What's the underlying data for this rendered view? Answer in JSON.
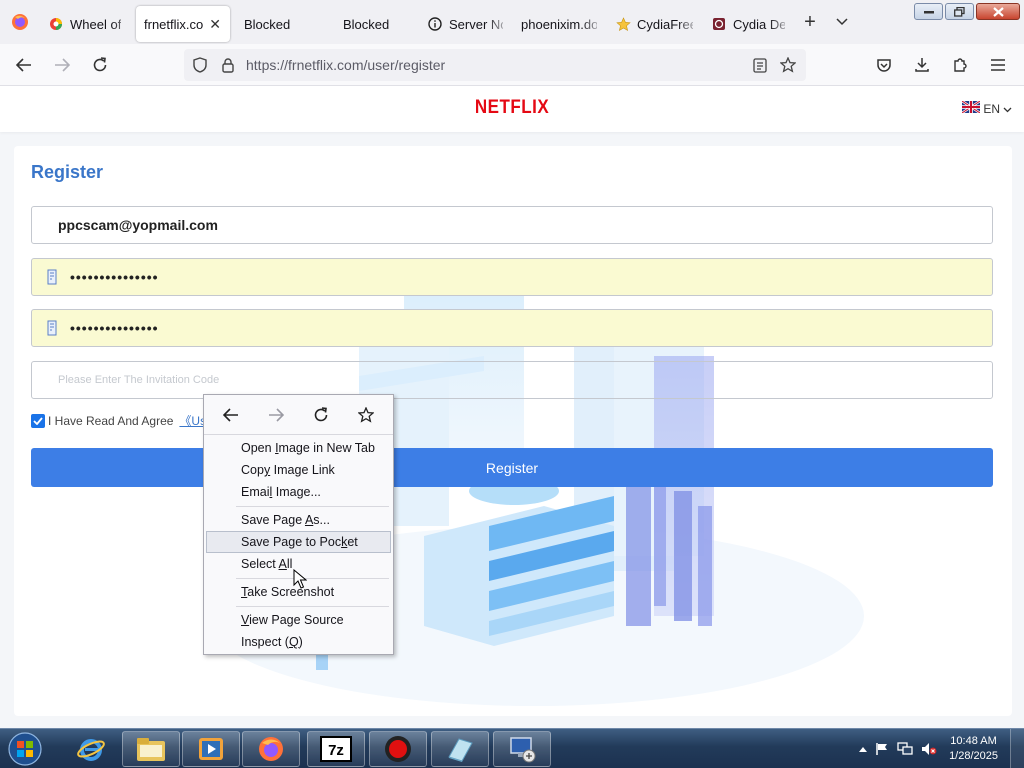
{
  "tabs": [
    {
      "title": "Wheel of",
      "icon": "colorful-circle-icon",
      "active": false
    },
    {
      "title": "frnetflix.co",
      "icon": "",
      "active": true,
      "close": "✕"
    },
    {
      "title": "Blocked",
      "icon": "",
      "active": false
    },
    {
      "title": "Blocked",
      "icon": "",
      "active": false
    },
    {
      "title": "Server No",
      "icon": "info-icon",
      "active": false
    },
    {
      "title": "phoenixim.do",
      "icon": "",
      "active": false
    },
    {
      "title": "CydiaFree",
      "icon": "star-icon",
      "active": false
    },
    {
      "title": "Cydia Der",
      "icon": "red-square-icon",
      "active": false
    }
  ],
  "browser": {
    "new_tab": "+",
    "url": "https://frnetflix.com/user/register"
  },
  "site": {
    "logo": "NETFLIX",
    "lang": "EN"
  },
  "form": {
    "title": "Register",
    "email": "ppcscam@yopmail.com",
    "password_mask": "•••••••••••••••",
    "confirm_mask": "•••••••••••••••",
    "invite_placeholder": "Please Enter The Invitation Code",
    "agree_text": "I Have Read And Agree",
    "agree_link": "《Use",
    "submit": "Register"
  },
  "context_menu": {
    "items_group1": [
      {
        "pre": "Open ",
        "acc": "I",
        "post": "mage in New Tab"
      },
      {
        "pre": "Cop",
        "acc": "y",
        "post": " Image Link"
      },
      {
        "pre": "Emai",
        "acc": "l",
        "post": " Image..."
      }
    ],
    "items_group2": [
      {
        "pre": "Save Page ",
        "acc": "A",
        "post": "s..."
      },
      {
        "pre": "Save Page to Poc",
        "acc": "k",
        "post": "et"
      },
      {
        "pre": "Select ",
        "acc": "A",
        "post": "ll"
      }
    ],
    "items_group3": [
      {
        "pre": "",
        "acc": "T",
        "post": "ake Screenshot"
      }
    ],
    "items_group4": [
      {
        "pre": "",
        "acc": "V",
        "post": "iew Page Source"
      },
      {
        "pre": "Inspect (",
        "acc": "Q",
        "post": ")"
      }
    ]
  },
  "taskbar": {
    "time": "10:48 AM",
    "date": "1/28/2025"
  },
  "colors": {
    "accent": "#3d7ee6",
    "title": "#3a76c9",
    "netflix_red": "#e50914",
    "autofill": "#fafad2"
  }
}
